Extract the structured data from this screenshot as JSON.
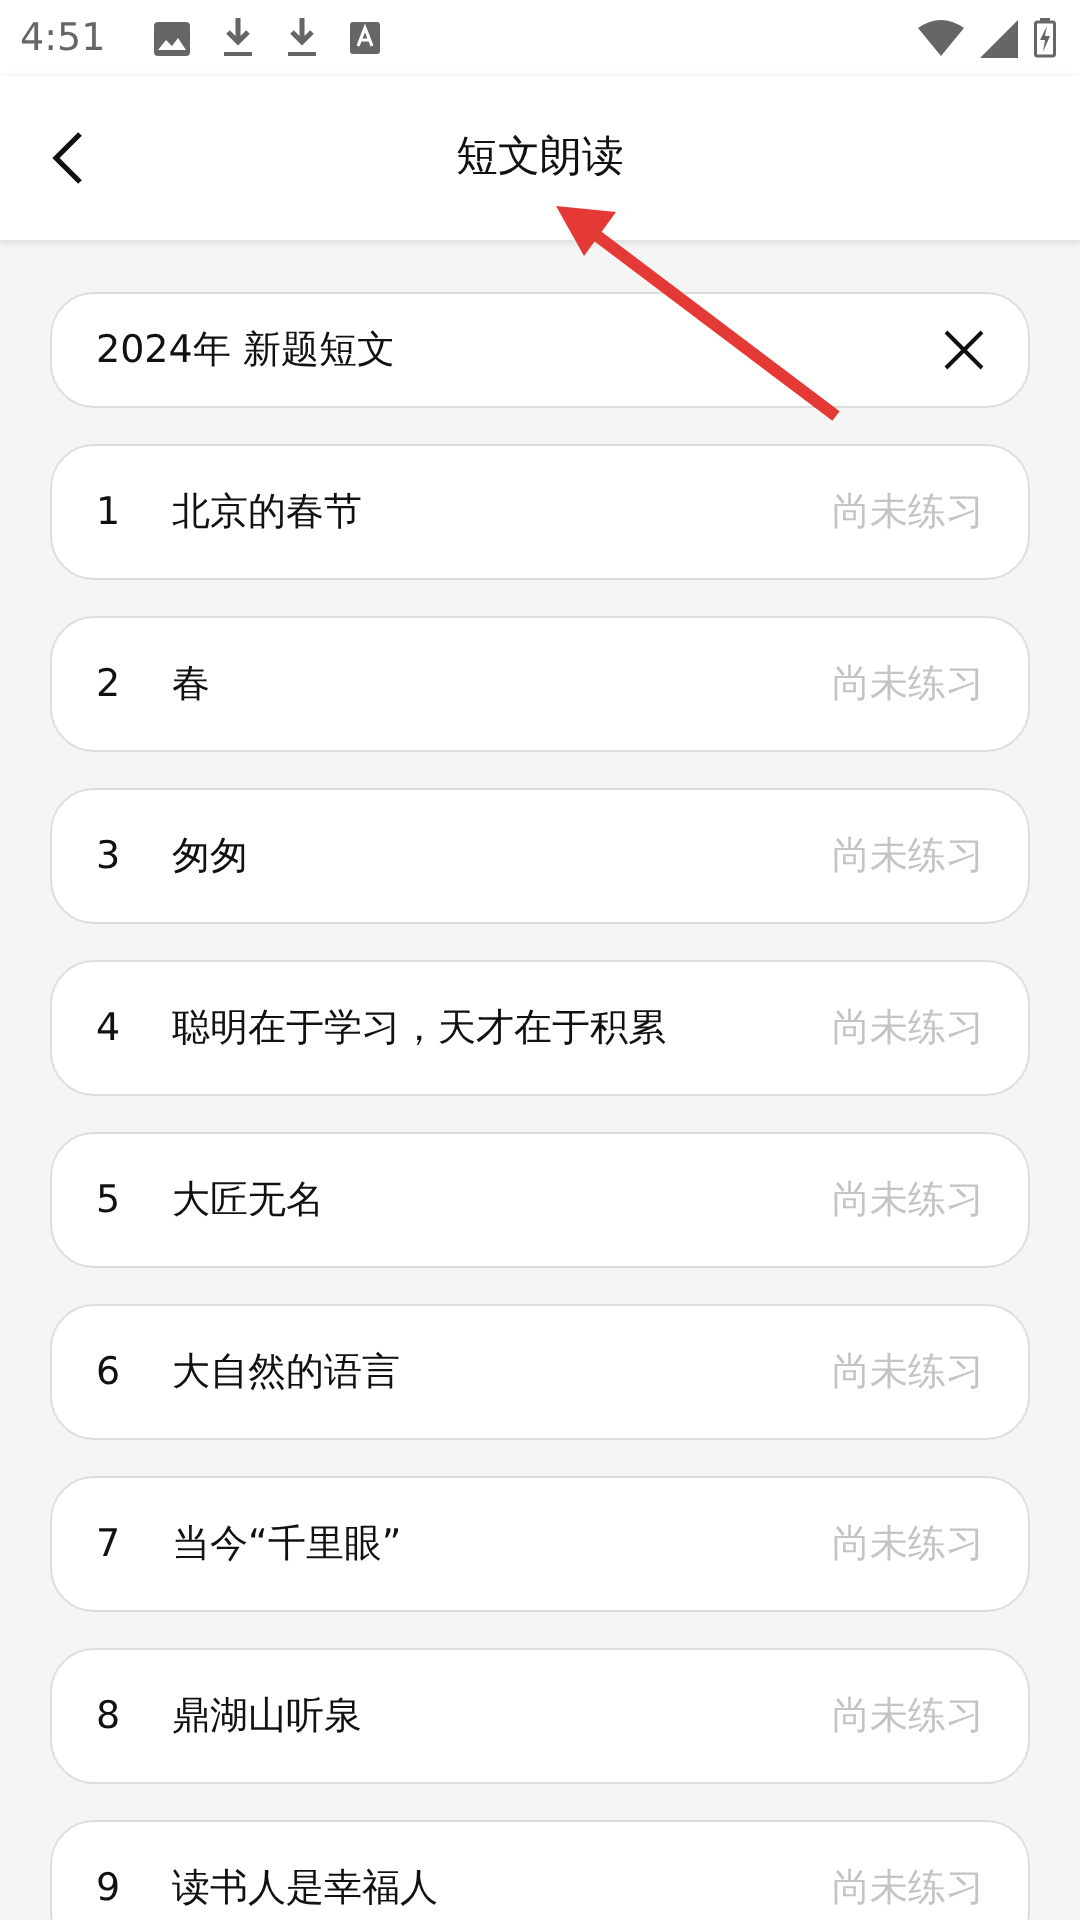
{
  "status_bar": {
    "time": "4:51"
  },
  "header": {
    "title": "短文朗读"
  },
  "filter": {
    "value": "2024年 新题短文"
  },
  "items": [
    {
      "number": "1",
      "title": "北京的春节",
      "status": "尚未练习"
    },
    {
      "number": "2",
      "title": "春",
      "status": "尚未练习"
    },
    {
      "number": "3",
      "title": "匆匆",
      "status": "尚未练习"
    },
    {
      "number": "4",
      "title": "聪明在于学习，天才在于积累",
      "status": "尚未练习"
    },
    {
      "number": "5",
      "title": "大匠无名",
      "status": "尚未练习"
    },
    {
      "number": "6",
      "title": "大自然的语言",
      "status": "尚未练习"
    },
    {
      "number": "7",
      "title": "当今“千里眼”",
      "status": "尚未练习"
    },
    {
      "number": "8",
      "title": "鼎湖山听泉",
      "status": "尚未练习"
    },
    {
      "number": "9",
      "title": "读书人是幸福人",
      "status": "尚未练习"
    }
  ]
}
